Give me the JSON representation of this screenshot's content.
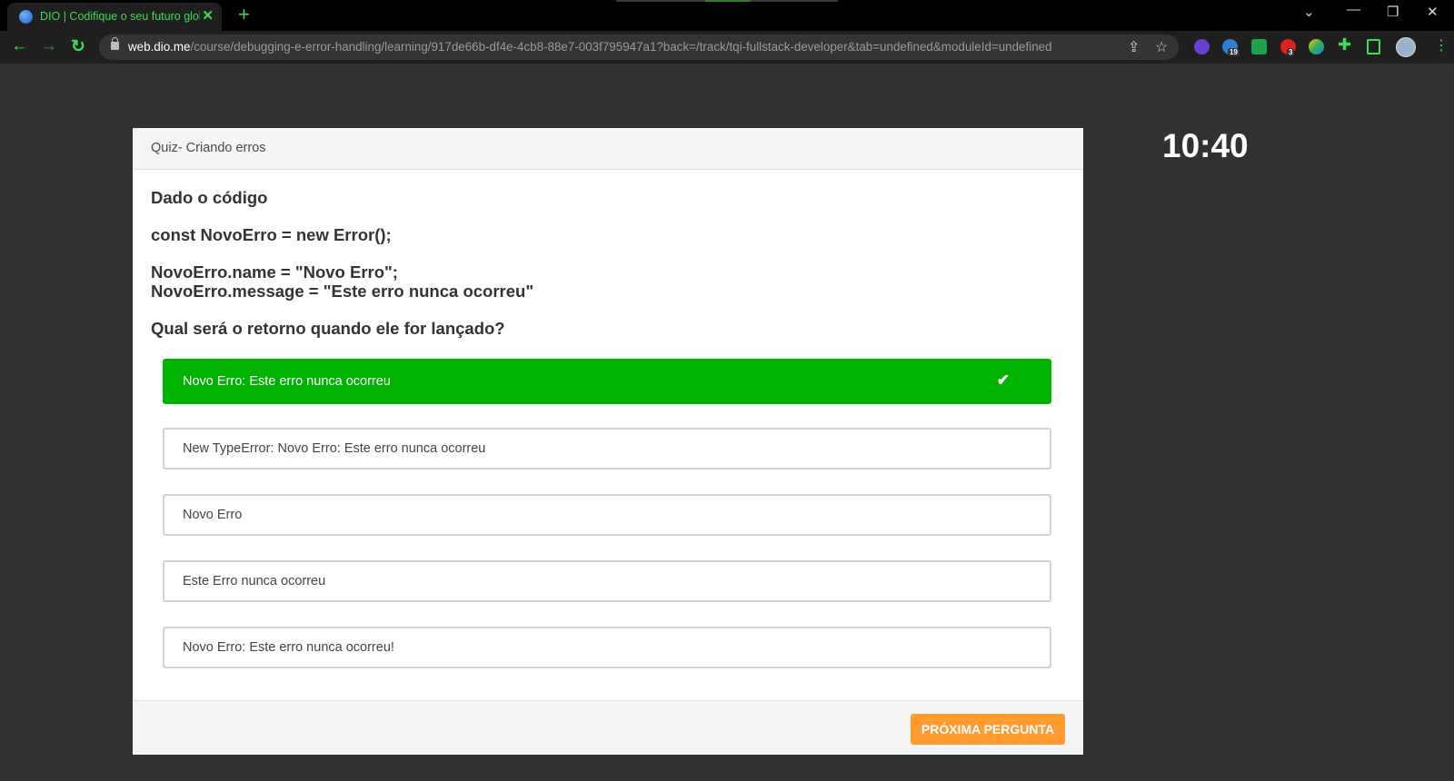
{
  "browser": {
    "tab_title": "DIO | Codifique o seu futuro global",
    "tab_close": "✕",
    "new_tab": "+",
    "url_host": "web.dio.me",
    "url_path": "/course/debugging-e-error-handling/learning/917de66b-df4e-4cb8-88e7-003f795947a1?back=/track/tqi-fullstack-developer&tab=undefined&moduleId=undefined",
    "extension_badges": [
      "19",
      "3"
    ],
    "accent_color": "#3ddc57"
  },
  "timer": "10:40",
  "quiz": {
    "title": "Quiz- Criando erros",
    "question_lines": [
      "Dado o código",
      "const NovoErro = new Error();",
      "NovoErro.name = \"Novo Erro\";",
      "NovoErro.message = \"Este erro nunca ocorreu\"",
      "Qual será o retorno quando ele for lançado?"
    ],
    "options": [
      {
        "label": "Novo Erro: Este erro nunca ocorreu",
        "selected": true
      },
      {
        "label": "New TypeError: Novo Erro: Este erro nunca ocorreu",
        "selected": false
      },
      {
        "label": "Novo Erro",
        "selected": false
      },
      {
        "label": "Este Erro nunca ocorreu",
        "selected": false
      },
      {
        "label": "Novo Erro: Este erro nunca ocorreu!",
        "selected": false
      }
    ],
    "selected_color": "#00b300",
    "next_button": "PRÓXIMA PERGUNTA",
    "next_button_color": "#ff9b2f"
  }
}
